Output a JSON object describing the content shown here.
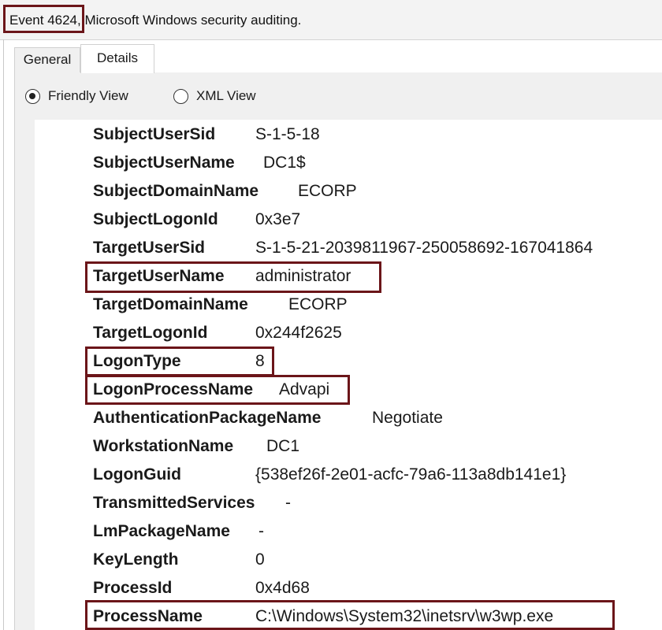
{
  "header": {
    "title": "Event 4624, Microsoft Windows security auditing."
  },
  "tabs": [
    {
      "label": "General",
      "active": false
    },
    {
      "label": "Details",
      "active": true
    }
  ],
  "view_options": [
    {
      "label": "Friendly View",
      "selected": true
    },
    {
      "label": "XML View",
      "selected": false
    }
  ],
  "event_data": [
    {
      "key": "SubjectUserSid",
      "value": "S-1-5-18"
    },
    {
      "key": "SubjectUserName",
      "value": "DC1$"
    },
    {
      "key": "SubjectDomainName",
      "value": "ECORP"
    },
    {
      "key": "SubjectLogonId",
      "value": "0x3e7"
    },
    {
      "key": "TargetUserSid",
      "value": "S-1-5-21-2039811967-250058692-167041864"
    },
    {
      "key": "TargetUserName",
      "value": "administrator",
      "highlighted": true
    },
    {
      "key": "TargetDomainName",
      "value": "ECORP"
    },
    {
      "key": "TargetLogonId",
      "value": "0x244f2625"
    },
    {
      "key": "LogonType",
      "value": "8",
      "highlighted": true
    },
    {
      "key": "LogonProcessName",
      "value": "Advapi",
      "highlighted": true
    },
    {
      "key": "AuthenticationPackageName",
      "value": "Negotiate"
    },
    {
      "key": "WorkstationName",
      "value": "DC1"
    },
    {
      "key": "LogonGuid",
      "value": "{538ef26f-2e01-acfc-79a6-113a8db141e1}"
    },
    {
      "key": "TransmittedServices",
      "value": "-"
    },
    {
      "key": "LmPackageName",
      "value": "-"
    },
    {
      "key": "KeyLength",
      "value": "0"
    },
    {
      "key": "ProcessId",
      "value": "0x4d68"
    },
    {
      "key": "ProcessName",
      "value": "C:\\Windows\\System32\\inetsrv\\w3wp.exe",
      "highlighted": true
    }
  ],
  "colors": {
    "highlight_border": "#6b1519"
  }
}
